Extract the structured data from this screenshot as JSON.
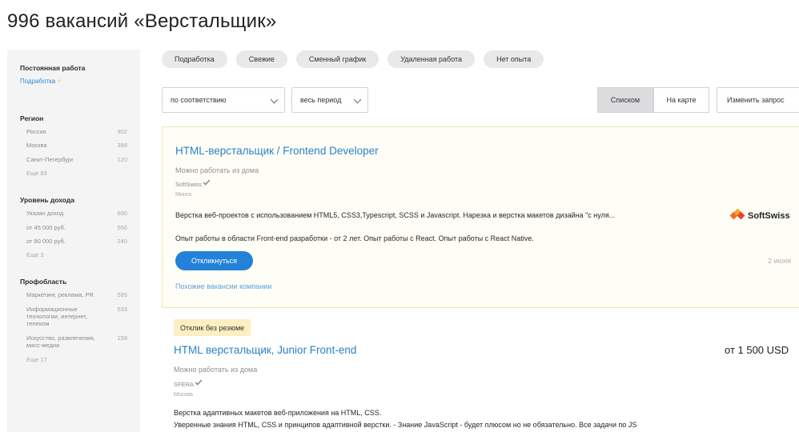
{
  "header": {
    "title": "996 вакансий «Верстальщик»"
  },
  "sidebar": {
    "employment_heading": "Постоянная работа",
    "employment_link": "Подработка",
    "employment_link_icon": "lightning-icon",
    "sections": [
      {
        "title": "Регион",
        "items": [
          {
            "label": "Россия",
            "count": "902"
          },
          {
            "label": "Москва",
            "count": "398"
          },
          {
            "label": "Санкт-Петербург",
            "count": "120"
          }
        ],
        "more": "Еще 93"
      },
      {
        "title": "Уровень дохода",
        "items": [
          {
            "label": "Указан доход",
            "count": "690"
          },
          {
            "label": "от 45 000 руб.",
            "count": "556"
          },
          {
            "label": "от 80 000 руб.",
            "count": "240"
          }
        ],
        "more": "Еще 3"
      },
      {
        "title": "Профобласть",
        "items": [
          {
            "label": "Маркетинг, реклама, PR",
            "count": "595"
          },
          {
            "label": "Информационные технологии, интернет, телеком",
            "count": "533"
          },
          {
            "label": "Искусство, развлечения, масс-медиа",
            "count": "158"
          }
        ],
        "more": "Еще 17"
      }
    ]
  },
  "chips": [
    "Подработка",
    "Свежие",
    "Сменный график",
    "Удаленная работа",
    "Нет опыта"
  ],
  "filters": {
    "sort": "по соответствию",
    "period": "весь период",
    "view_list": "Списком",
    "view_map": "На карте",
    "change_query": "Изменить запрос"
  },
  "vacancies": [
    {
      "title": "HTML-верстальщик / Frontend Developer",
      "remote": "Можно работать из дома",
      "company": "SoftSwiss",
      "city": "Минск",
      "desc1": "Верстка веб-проектов с использованием HTML5, CSS3,Typescript, SCSS и Javascript. Нарезка и верстка макетов дизайна \"с нуля...",
      "desc2": "Опыт работы в области Front-end разработки - от 2 лет. Опыт работы с React. Опыт работы с React Native.",
      "respond": "Откликнуться",
      "similar": "Похожие вакансии компании",
      "logo_text": "SoftSwiss",
      "date": "2 июня"
    },
    {
      "badge": "Отклик без резюме",
      "title": "HTML верстальщик, Junior Front-end",
      "salary": "от 1 500 USD",
      "remote": "Можно работать из дома",
      "company": "SFERA",
      "city": "Москва",
      "desc1": "Верстка адаптивных макетов веб-приложения на HTML, CSS.",
      "desc2": "Уверенные знания HTML, CSS и принципов адаптивной верстки. - Знание JavaScript - будет плюсом но не обязательно. Все задачи по JS"
    }
  ],
  "colors": {
    "link": "#2a82c9",
    "primary_button": "#2382d8",
    "highlight_card_bg": "#fffef6",
    "badge_bg": "#fdefc2"
  }
}
